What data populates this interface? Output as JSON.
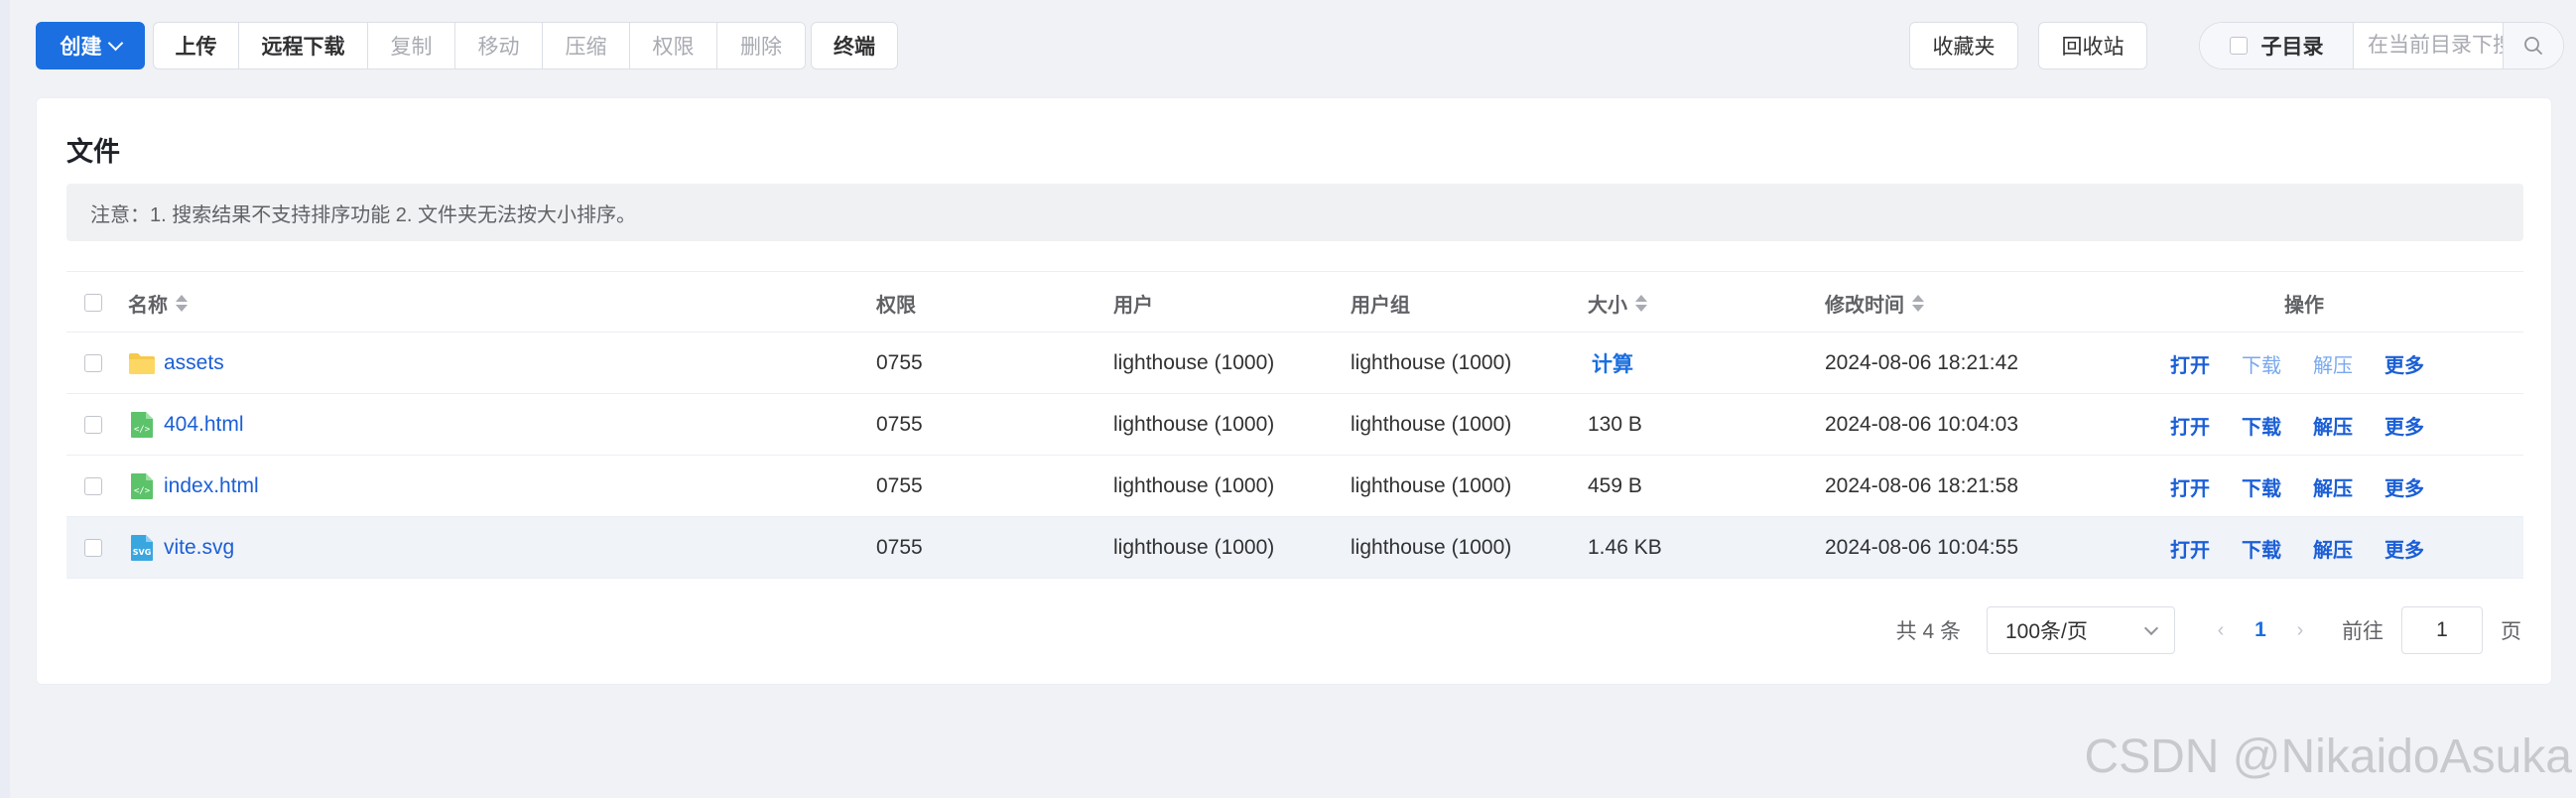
{
  "toolbar": {
    "create": "创建",
    "upload": "上传",
    "remote_download": "远程下载",
    "copy": "复制",
    "move": "移动",
    "compress": "压缩",
    "permission": "权限",
    "delete": "删除",
    "terminal": "终端",
    "favorites": "收藏夹",
    "recycle_bin": "回收站",
    "subdir_label": "子目录",
    "search_placeholder": "在当前目录下搜索"
  },
  "card": {
    "title": "文件",
    "notice": "注意：1. 搜索结果不支持排序功能 2. 文件夹无法按大小排序。"
  },
  "table": {
    "headers": {
      "name": "名称",
      "perm": "权限",
      "user": "用户",
      "group": "用户组",
      "size": "大小",
      "mtime": "修改时间",
      "ops": "操作"
    },
    "rows": [
      {
        "icon": "folder-icon",
        "name": "assets",
        "perm": "0755",
        "user": "lighthouse (1000)",
        "group": "lighthouse (1000)",
        "size": "计算",
        "mtime": "2024-08-06 18:21:42",
        "ops": [
          "打开",
          "下载",
          "解压",
          "更多"
        ]
      },
      {
        "icon": "html-file-icon",
        "name": "404.html",
        "perm": "0755",
        "user": "lighthouse (1000)",
        "group": "lighthouse (1000)",
        "size": "130 B",
        "mtime": "2024-08-06 10:04:03",
        "ops": [
          "打开",
          "下载",
          "解压",
          "更多"
        ]
      },
      {
        "icon": "html-file-icon",
        "name": "index.html",
        "perm": "0755",
        "user": "lighthouse (1000)",
        "group": "lighthouse (1000)",
        "size": "459 B",
        "mtime": "2024-08-06 18:21:58",
        "ops": [
          "打开",
          "下载",
          "解压",
          "更多"
        ]
      },
      {
        "icon": "svg-file-icon",
        "name": "vite.svg",
        "perm": "0755",
        "user": "lighthouse (1000)",
        "group": "lighthouse (1000)",
        "size": "1.46 KB",
        "mtime": "2024-08-06 10:04:55",
        "ops": [
          "打开",
          "下载",
          "解压",
          "更多"
        ]
      }
    ]
  },
  "pager": {
    "total": "共 4 条",
    "page_size": "100条/页",
    "current_page": "1",
    "goto_label": "前往",
    "goto_value": "1",
    "page_suffix": "页"
  },
  "watermark": "CSDN @NikaidoAsuka",
  "colors": {
    "primary": "#1b6fe0",
    "link": "#1b5fd6"
  }
}
